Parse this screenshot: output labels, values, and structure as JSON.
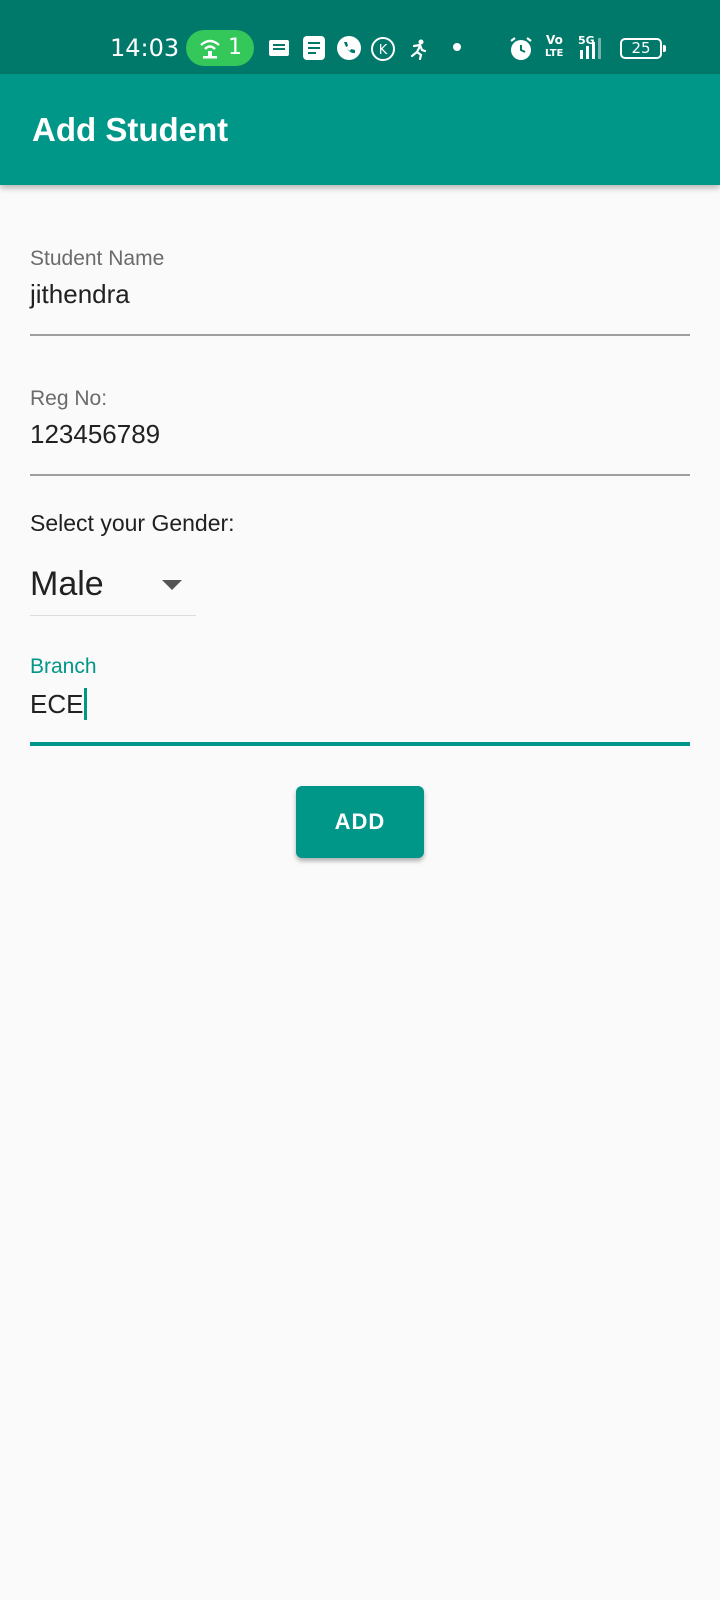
{
  "status_bar": {
    "time": "14:03",
    "hotspot_count": "1",
    "volte_label": "Vo",
    "lte_label": "LTE",
    "network_label": "5G",
    "battery_level": "25",
    "icons": [
      "hotspot-icon",
      "message-icon",
      "notes-icon",
      "phone-icon",
      "k-app-icon",
      "running-icon",
      "dot-icon",
      "alarm-icon",
      "signal-icon",
      "battery-icon"
    ]
  },
  "app_bar": {
    "title": "Add Student"
  },
  "form": {
    "student_name": {
      "label": "Student Name",
      "value": "jithendra"
    },
    "reg_no": {
      "label": "Reg No:",
      "value": "123456789"
    },
    "gender": {
      "label": "Select your Gender:",
      "selected": "Male"
    },
    "branch": {
      "label": "Branch",
      "value": "ECE"
    },
    "add_button_label": "ADD"
  },
  "colors": {
    "status_bar": "#00796b",
    "primary": "#009688",
    "background": "#fafafa",
    "hotspot_pill": "#34c759"
  }
}
